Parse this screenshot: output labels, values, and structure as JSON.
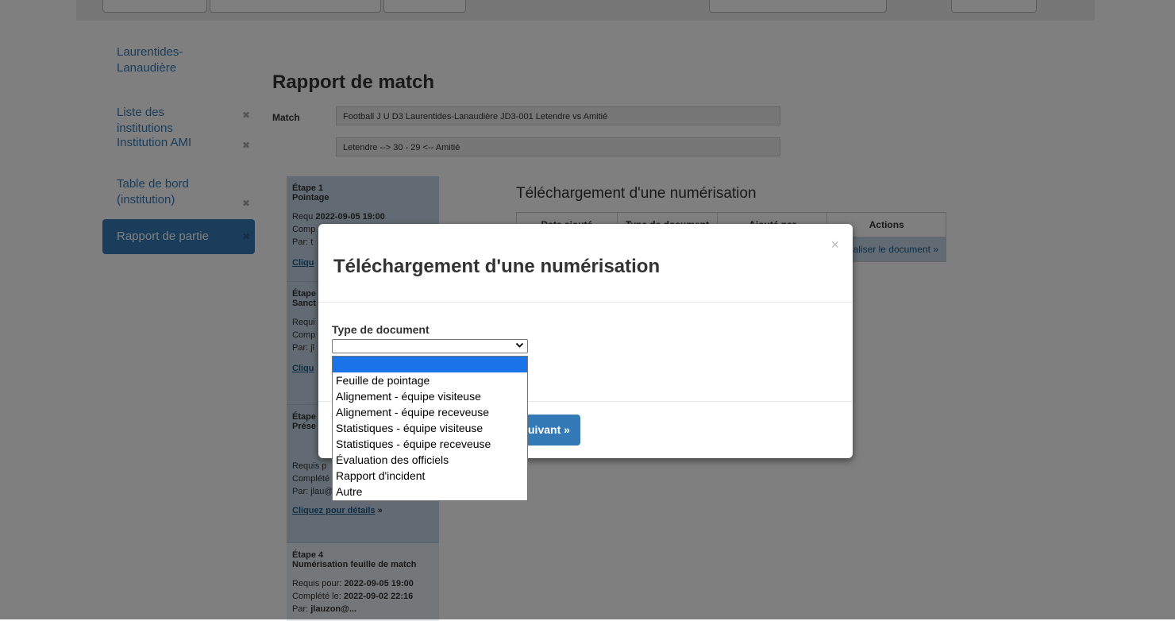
{
  "sidebar": {
    "items": [
      {
        "label": "Laurentides-Lanaudière",
        "closable": false,
        "active": false
      },
      {
        "label": "Liste des institutions",
        "closable": true,
        "active": false
      },
      {
        "label": "Institution AMI",
        "closable": true,
        "active": false
      },
      {
        "label": "Table de bord (institution)",
        "closable": true,
        "active": false
      },
      {
        "label": "Rapport de partie",
        "closable": true,
        "active": true
      }
    ],
    "close_glyph": "✖"
  },
  "page": {
    "title": "Rapport de match",
    "match_label": "Match",
    "match_value": "Football J U D3 Laurentides-Lanaudière JD3-001 Letendre vs Amitié",
    "score_value": "Letendre --> 30 - 29 <-- Amitié"
  },
  "steps": [
    {
      "step": "Étape 1",
      "name": "Pointage",
      "req": "Requ",
      "req_date": "2022-09-05 19:00",
      "comp": "Comp",
      "by": "Par: t",
      "detail": "Cliqu"
    },
    {
      "step": "Étape",
      "name": "Sanct",
      "req": "Requi",
      "comp": "Comp",
      "by": "Par: jl",
      "detail": "Cliqu"
    },
    {
      "step": "Étape",
      "name": "Prése",
      "req": "Requis p",
      "comp": "Complété",
      "by": "Par: jlau",
      "by_rest": "@...eq.ca",
      "detail": "Cliquez pour détails",
      "detail_suffix": " »"
    },
    {
      "step": "Étape 4",
      "name": "Numérisation feuille de match",
      "req": "Requis pour:",
      "req_date": "2022-09-05 19:00",
      "comp": "Complété le:",
      "comp_date": "2022-09-02 22:16",
      "by": "Par:",
      "by_value": "jlauzon@..."
    }
  ],
  "upload_section": {
    "title": "Téléchargement d'une numérisation",
    "columns": [
      "Date ajouté",
      "Type de document",
      "Ajouté par",
      "Actions"
    ],
    "row_action": "Visualiser le document »"
  },
  "modal": {
    "title": "Téléchargement d'une numérisation",
    "close_glyph": "×",
    "doc_type_label": "Type de document",
    "selected_value": "",
    "next_label": "Suivant »",
    "next_visible": "uivant »"
  },
  "dropdown": {
    "options": [
      "",
      "Feuille de pointage",
      "Alignement - équipe visiteuse",
      "Alignement - équipe receveuse",
      "Statistiques - équipe visiteuse",
      "Statistiques - équipe receveuse",
      "Évaluation des officiels",
      "Rapport d'incident",
      "Autre"
    ]
  }
}
